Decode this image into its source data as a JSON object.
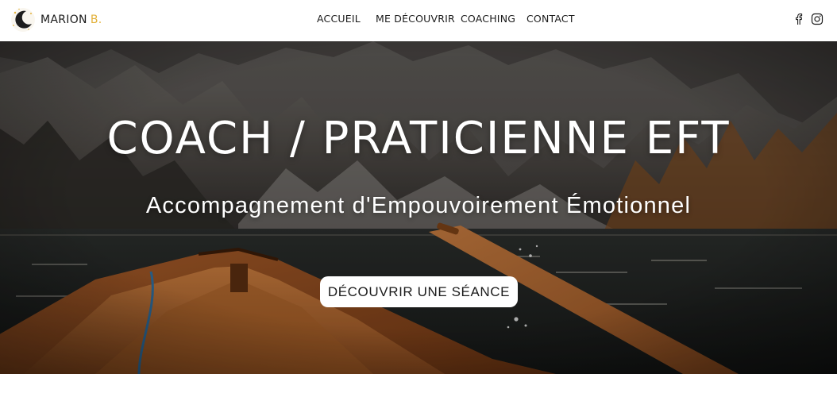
{
  "brand": {
    "name": "MARION",
    "accent": "B.",
    "accent_color": "#e3b23c"
  },
  "nav": {
    "items": [
      {
        "label": "ACCUEIL"
      },
      {
        "label": "ME DÉCOUVRIR"
      },
      {
        "label": "COACHING"
      },
      {
        "label": "CONTACT"
      }
    ]
  },
  "social": {
    "facebook_icon": "facebook-icon",
    "instagram_icon": "instagram-icon"
  },
  "hero": {
    "title": "COACH / PRATICIENNE EFT",
    "subtitle": "Accompagnement d'Empouvoirement Émotionnel",
    "cta_label": "DÉCOUVRIR UNE SÉANCE",
    "background": "mountain lake with wooden rowboat"
  },
  "colors": {
    "header_bg": "#ffffff",
    "text_dark": "#1b1b1b",
    "button_bg": "#ffffff"
  }
}
